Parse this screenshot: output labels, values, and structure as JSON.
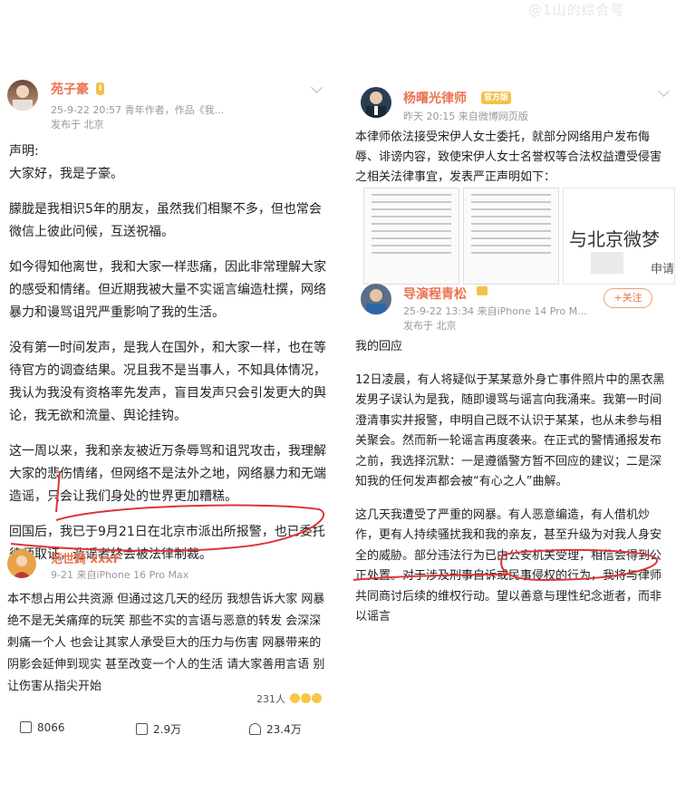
{
  "watermark": "@1山的综合号",
  "left_post": {
    "author": "苑子豪",
    "badge": "I",
    "date_line": "25-9-22 20:57 青年作者，作品《我...",
    "location": "发布于 北京",
    "paragraphs": [
      "声明:",
      "大家好，我是子豪。",
      "朦胧是我相识5年的朋友，虽然我们相聚不多，但也常会微信上彼此问候，互送祝福。",
      "如今得知他离世，我和大家一样悲痛，因此非常理解大家的感受和情绪。但近期我被大量不实谣言编造杜撰，网络暴力和谩骂诅咒严重影响了我的生活。",
      "没有第一时间发声，是我人在国外，和大家一样，也在等待官方的调查结果。况且我不是当事人，不知具体情况，我认为我没有资格率先发声，盲目发声只会引发更大的舆论，我无欲和流量、舆论挂钩。",
      "这一周以来，我和亲友被近万条辱骂和诅咒攻击，我理解大家的悲伤情绪，但网络不是法外之地，网络暴力和无端造谣，只会让我们身处的世界更加糟糕。",
      "回国后，我已于9月21日在北京市派出所报警，也已委托律师取证，造谣者终会被法律制裁。"
    ],
    "comment": {
      "author": "范世錡 xxxF",
      "time": "9-21 来自iPhone 16 Pro Max",
      "text": "本不想占用公共资源 但通过这几天的经历 我想告诉大家 网暴绝不是无关痛痒的玩笑 那些不实的言语与恶意的转发 会深深刺痛一个人 也会让其家人承受巨大的压力与伤害 网暴带来的阴影会延伸到现实 甚至改变一个人的生活 请大家善用言语 别让伤害从指尖开始",
      "likes": "231人"
    },
    "actions": {
      "reposts": "8066",
      "comments": "2.9万",
      "likes": "23.4万"
    }
  },
  "right_post": {
    "author": "杨曙光律师",
    "badge": "官方版",
    "date_line": "昨天 20:15 来自微博网页版",
    "text": "本律师依法接受宋伊人女士委托，就部分网络用户发布侮辱、诽谤内容，致使宋伊人女士名誉权等合法权益遭受侵害之相关法律事宜，发表严正声明如下：",
    "image_text": "与北京微梦",
    "image_text2": "申请",
    "repost": {
      "author": "导演程青松",
      "follow": "+关注",
      "time": "25-9-22 13:34 来自iPhone 14 Pro M...",
      "location": "发布于 北京",
      "paragraphs": [
        "我的回应",
        "12日凌晨，有人将疑似于某某意外身亡事件照片中的黑衣黑发男子误认为是我，随即谩骂与谣言向我涌来。我第一时间澄清事实并报警，申明自己既不认识于某某，也从未参与相关聚会。然而新一轮谣言再度袭来。在正式的警情通报发布之前，我选择沉默：一是遵循警方暂不回应的建议；二是深知我的任何发声都会被“有心之人”曲解。",
        "这几天我遭受了严重的网暴。有人恶意编造，有人借机炒作，更有人持续骚扰我和我的亲友，甚至升级为对我人身安全的威胁。部分违法行为已由公安机关受理，相信会得到公正处置。对于涉及刑事自诉或民事侵权的行为，我将与律师共同商讨后续的维权行动。望以善意与理性纪念逝者，而非以谣言"
      ]
    }
  }
}
